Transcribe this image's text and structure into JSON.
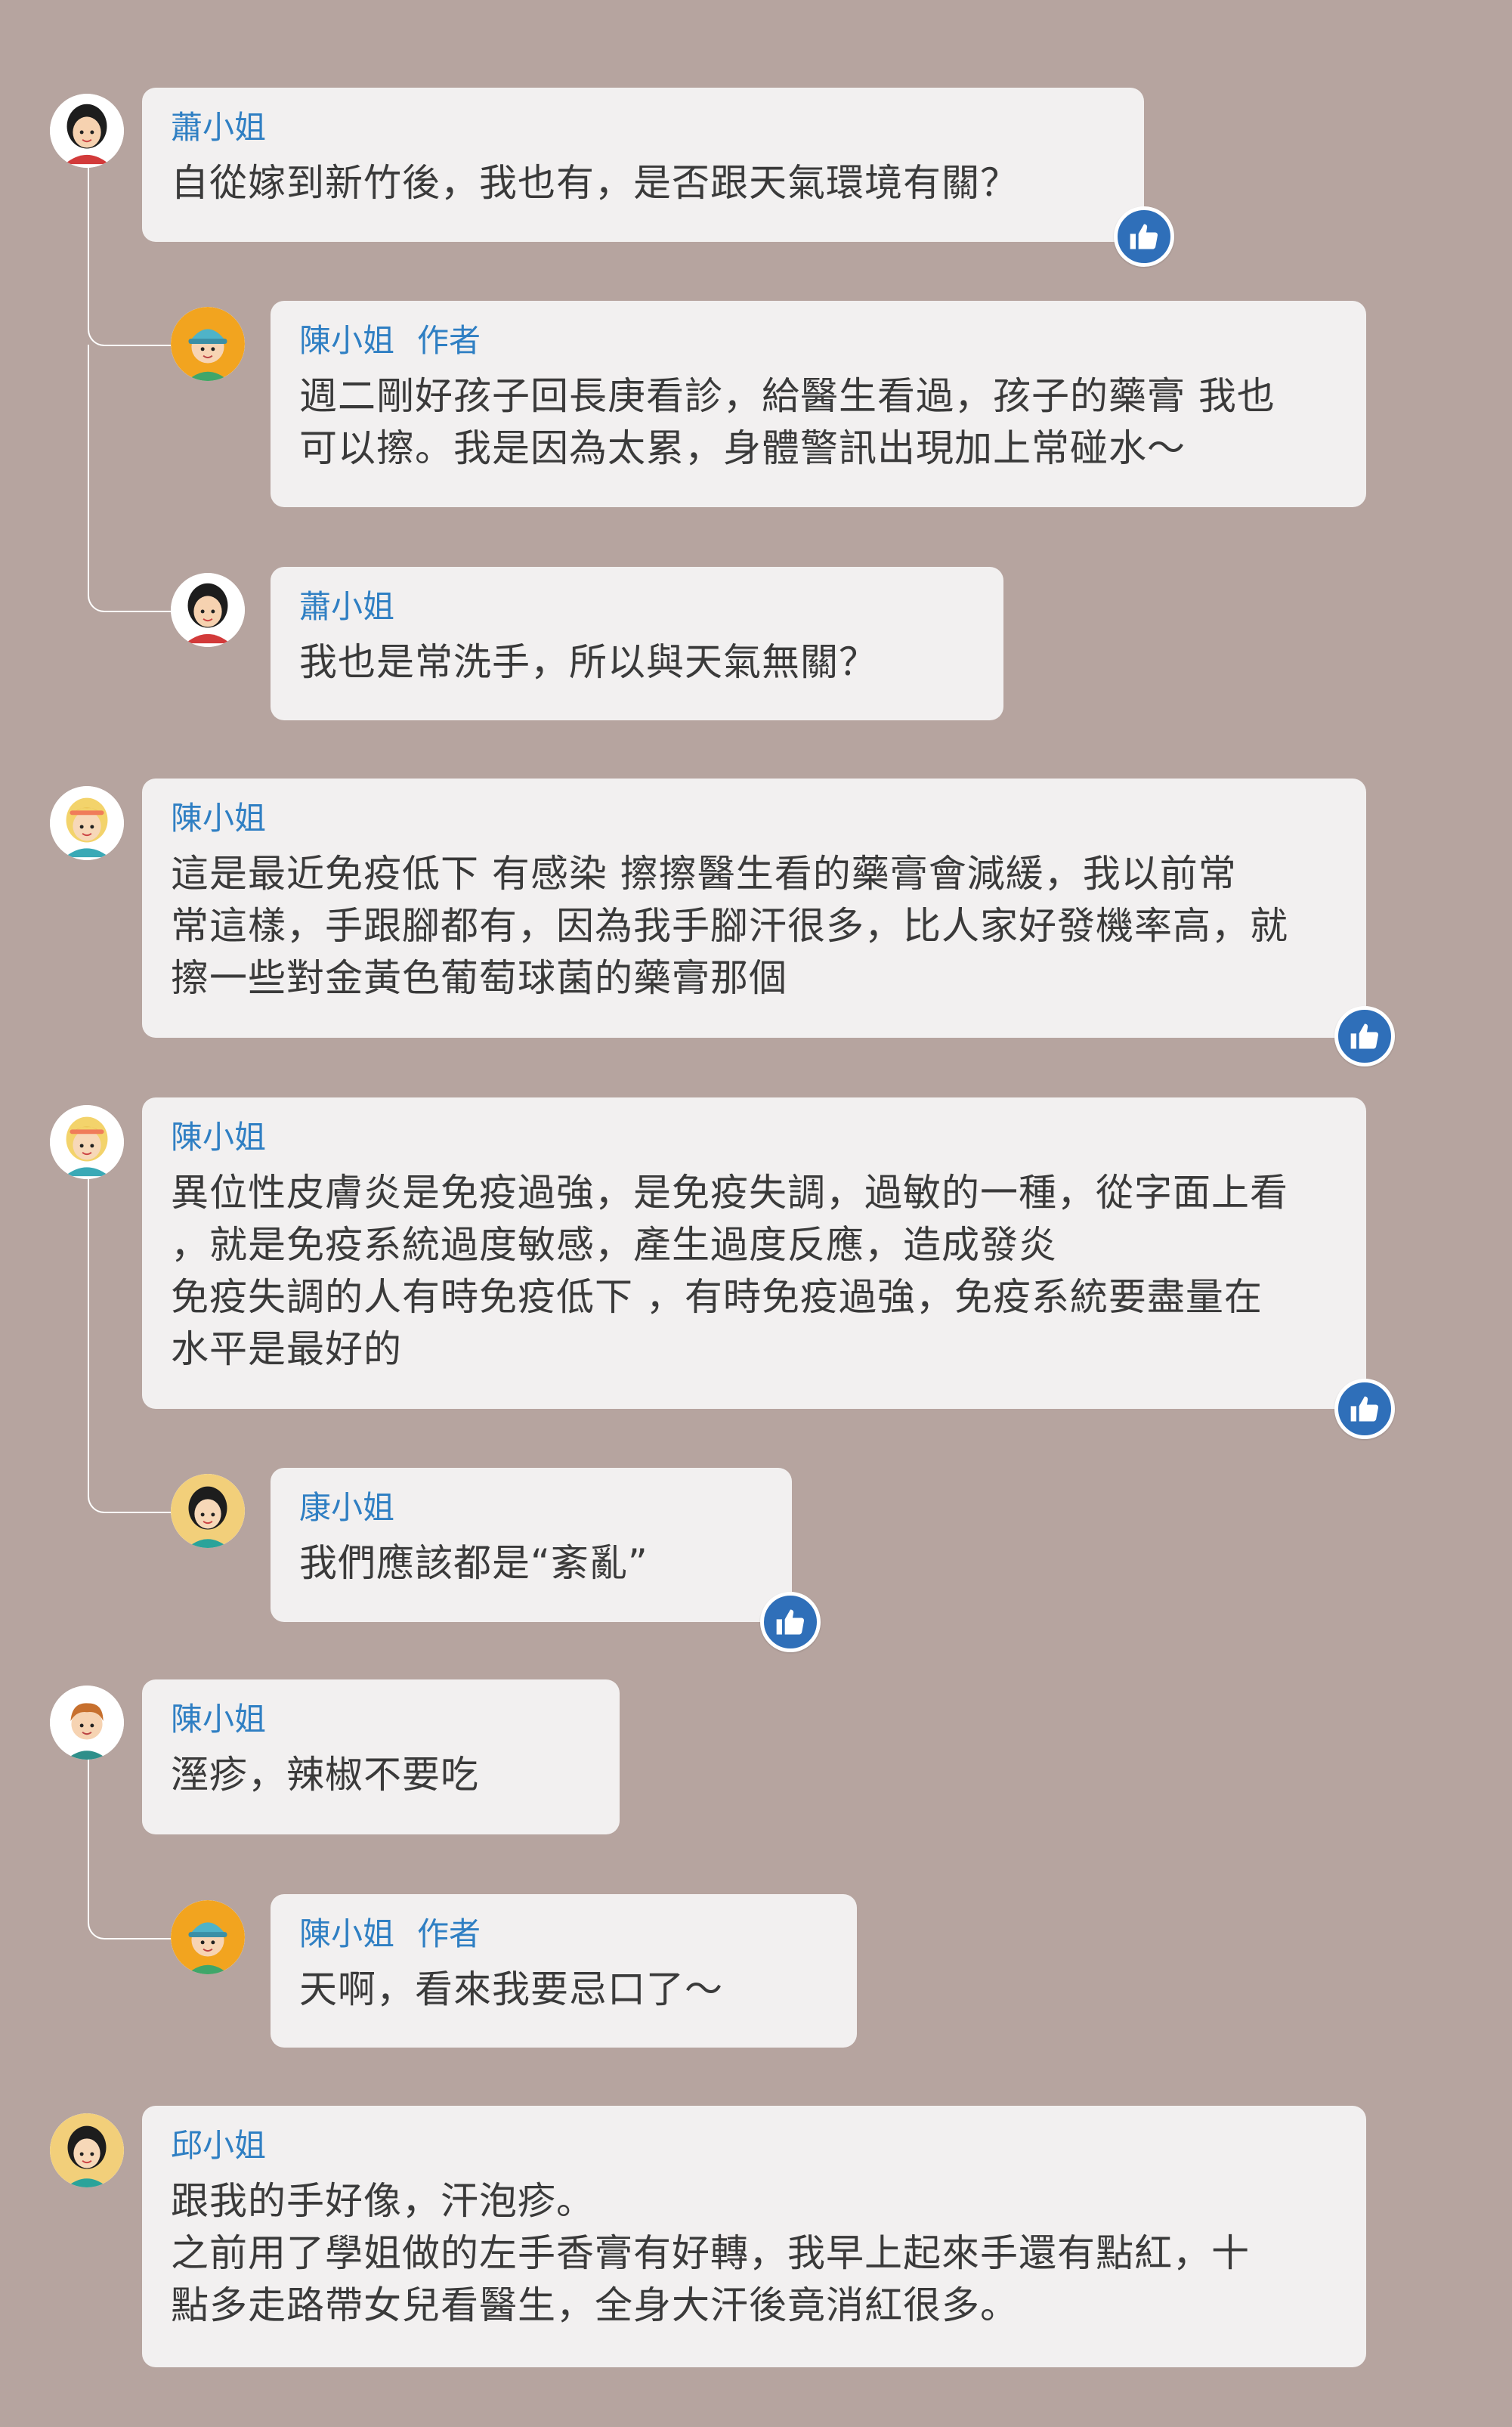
{
  "comments": [
    {
      "author": "蕭小姐",
      "text": "自從嫁到新竹後，我也有，是否跟天氣環境有關？"
    },
    {
      "author": "陳小姐",
      "tag": "作者",
      "text": "週二剛好孩子回長庚看診，給醫生看過，孩子的藥膏 我也\n可以擦。我是因為太累，身體警訊出現加上常碰水～"
    },
    {
      "author": "蕭小姐",
      "text": "我也是常洗手，所以與天氣無關？"
    },
    {
      "author": "陳小姐",
      "text": "這是最近免疫低下 有感染 擦擦醫生看的藥膏會減緩，我以前常\n常這樣，手跟腳都有，因為我手腳汗很多，比人家好發機率高，就\n擦一些對金黃色葡萄球菌的藥膏那個"
    },
    {
      "author": "陳小姐",
      "text": "異位性皮膚炎是免疫過強，是免疫失調，過敏的一種，從字面上看\n，就是免疫系統過度敏感，產生過度反應，造成發炎\n免疫失調的人有時免疫低下 ，有時免疫過強，免疫系統要盡量在\n水平是最好的"
    },
    {
      "author": "康小姐",
      "text": "我們應該都是“紊亂”"
    },
    {
      "author": "陳小姐",
      "text": "溼疹，辣椒不要吃"
    },
    {
      "author": "陳小姐",
      "tag": "作者",
      "text": "天啊，看來我要忌口了～"
    },
    {
      "author": "邱小姐",
      "text": "跟我的手好像，汗泡疹。\n之前用了學姐做的左手香膏有好轉，我早上起來手還有點紅，十\n點多走路帶女兒看醫生，全身大汗後竟消紅很多。"
    }
  ],
  "icons": {
    "like": "thumbs-up-icon",
    "avatar_woman": "woman-avatar-icon",
    "avatar_blonde": "blonde-woman-avatar-icon",
    "avatar_kid": "kid-cap-avatar-icon",
    "avatar_man": "man-avatar-icon"
  },
  "colors": {
    "background": "#b6a49f",
    "bubble": "#f2f0f0",
    "author": "#2f7fc3",
    "like": "#2f6fb9",
    "text": "#3a3a3a"
  }
}
